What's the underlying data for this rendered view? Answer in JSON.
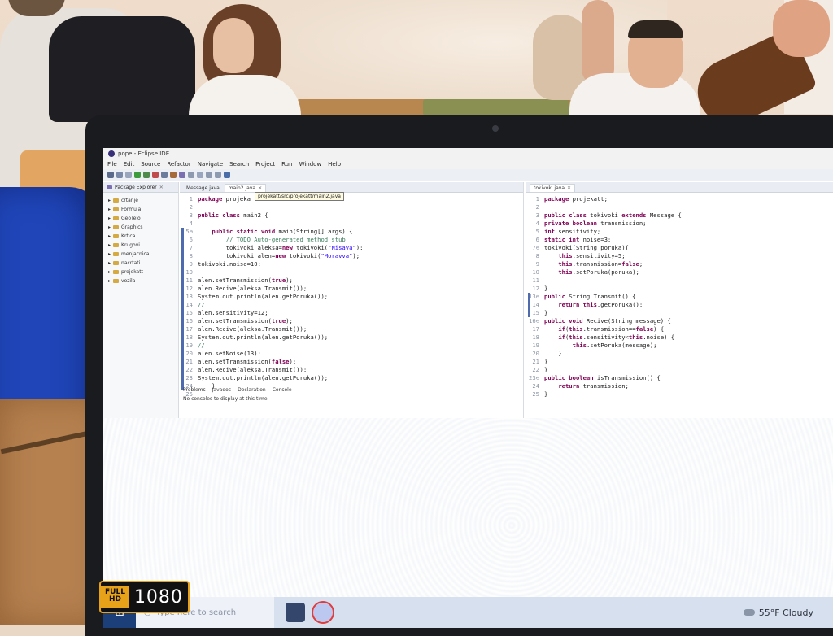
{
  "eclipse": {
    "window_title": "pope - Eclipse IDE",
    "menu": [
      "File",
      "Edit",
      "Source",
      "Refactor",
      "Navigate",
      "Search",
      "Project",
      "Run",
      "Window",
      "Help"
    ],
    "package_explorer": {
      "label": "Package Explorer",
      "items": [
        "crtanje",
        "Formula",
        "GeoTelo",
        "Graphics",
        "Krtica",
        "Krugovi",
        "menjacnica",
        "nacrtati",
        "projekatt",
        "vozila"
      ]
    },
    "left_editor": {
      "tabs": [
        {
          "label": "Message.java",
          "active": false
        },
        {
          "label": "main2.java",
          "active": true
        }
      ],
      "tooltip": "projekatt/src/projekatt/main2.java",
      "lines": [
        {
          "n": "1",
          "text": "package projeka"
        },
        {
          "n": "2",
          "text": ""
        },
        {
          "n": "3",
          "text": "public class main2 {"
        },
        {
          "n": "4",
          "text": ""
        },
        {
          "n": "5⊖",
          "text": "    public static void main(String[] args) {"
        },
        {
          "n": "6",
          "text": "        // TODO Auto-generated method stub"
        },
        {
          "n": "7",
          "text": "        tokivoki aleksa=new tokivoki(\"Nisava\");"
        },
        {
          "n": "8",
          "text": "        tokivoki alen=new tokivoki(\"Moravva\");"
        },
        {
          "n": "9",
          "text": "tokivoki.noise=10;"
        },
        {
          "n": "10",
          "text": ""
        },
        {
          "n": "11",
          "text": "alen.setTransmission(true);"
        },
        {
          "n": "12",
          "text": "alen.Recive(aleksa.Transmit());"
        },
        {
          "n": "13",
          "text": "System.out.println(alen.getPoruka());"
        },
        {
          "n": "14",
          "text": "//"
        },
        {
          "n": "15",
          "text": "alen.sensitivity=12;"
        },
        {
          "n": "16",
          "text": "alen.setTransmission(true);"
        },
        {
          "n": "17",
          "text": "alen.Recive(aleksa.Transmit());"
        },
        {
          "n": "18",
          "text": "System.out.println(alen.getPoruka());"
        },
        {
          "n": "19",
          "text": "//"
        },
        {
          "n": "20",
          "text": "alen.setNoise(13);"
        },
        {
          "n": "21",
          "text": "alen.setTransmission(false);"
        },
        {
          "n": "22",
          "text": "alen.Recive(aleksa.Transmit());"
        },
        {
          "n": "23",
          "text": "System.out.println(alen.getPoruka());"
        },
        {
          "n": "24",
          "text": "    }"
        },
        {
          "n": "25",
          "text": ""
        }
      ]
    },
    "right_editor": {
      "tabs": [
        {
          "label": "tokivoki.java",
          "active": true
        }
      ],
      "lines": [
        {
          "n": "1",
          "text": "package projekatt;"
        },
        {
          "n": "2",
          "text": ""
        },
        {
          "n": "3",
          "text": "public class tokivoki extends Message {"
        },
        {
          "n": "4",
          "text": "private boolean transmission;"
        },
        {
          "n": "5",
          "text": "int sensitivity;"
        },
        {
          "n": "6",
          "text": "static int noise=3;"
        },
        {
          "n": "7⊖",
          "text": "tokivoki(String poruka){"
        },
        {
          "n": "8",
          "text": "    this.sensitivity=5;"
        },
        {
          "n": "9",
          "text": "    this.transmission=false;"
        },
        {
          "n": "10",
          "text": "    this.setPoruka(poruka);"
        },
        {
          "n": "11",
          "text": ""
        },
        {
          "n": "12",
          "text": "}"
        },
        {
          "n": "13⊖",
          "text": "public String Transmit() {"
        },
        {
          "n": "14",
          "text": "    return this.getPoruka();"
        },
        {
          "n": "15",
          "text": "}"
        },
        {
          "n": "16⊖",
          "text": "public void Recive(String message) {"
        },
        {
          "n": "17",
          "text": "    if(this.transmission==false) {"
        },
        {
          "n": "18",
          "text": "    if(this.sensitivity<this.noise) {"
        },
        {
          "n": "19",
          "text": "        this.setPoruka(message);"
        },
        {
          "n": "20",
          "text": "    }"
        },
        {
          "n": "21",
          "text": "}"
        },
        {
          "n": "22",
          "text": "}"
        },
        {
          "n": "23⊖",
          "text": "public boolean isTransmission() {"
        },
        {
          "n": "24",
          "text": "    return transmission;"
        },
        {
          "n": "25",
          "text": "}"
        }
      ]
    },
    "console": {
      "tabs": [
        "Problems",
        "Javadoc",
        "Declaration",
        "Console"
      ],
      "message": "No consoles to display at this time."
    }
  },
  "taskbar": {
    "search_placeholder": "Type here to search",
    "weather": "55°F Cloudy"
  },
  "badge": {
    "small_top": "FULL",
    "small_bottom": "HD",
    "big": "1080"
  },
  "colors": {
    "laptop_bezel": "#1a1b1f",
    "taskbar": "#d6e0ef",
    "jacket": "#1f45b8",
    "badge_accent": "#e8a21a"
  }
}
